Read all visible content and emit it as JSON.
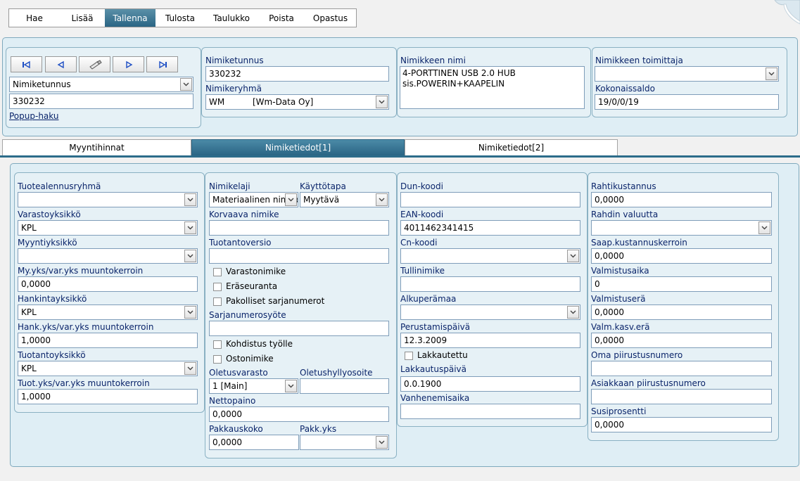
{
  "menu": [
    "Hae",
    "Lisää",
    "Tallenna",
    "Tulosta",
    "Taulukko",
    "Poista",
    "Opastus"
  ],
  "active_menu": "Tallenna",
  "search": {
    "field_select": "Nimiketunnus",
    "value": "330232",
    "popup_link": "Popup-haku"
  },
  "header": {
    "nimiketunnus_label": "Nimiketunnus",
    "nimiketunnus_value": "330232",
    "nimikeryhma_label": "Nimikeryhmä",
    "nimikeryhma_code": "WM",
    "nimikeryhma_name": "[Wm-Data Oy]",
    "nimi_label": "Nimikkeen nimi",
    "nimi_line1": "4-PORTTINEN USB 2.0 HUB",
    "nimi_line2": "sis.POWERIN+KAAPELIN",
    "toimittaja_label": "Nimikkeen toimittaja",
    "toimittaja_value": "",
    "kokonaissaldo_label": "Kokonaissaldo",
    "kokonaissaldo_value": "19/0/0/19"
  },
  "tabs": [
    "Myyntihinnat",
    "Nimiketiedot[1]",
    "Nimiketiedot[2]"
  ],
  "active_tab": "Nimiketiedot[1]",
  "col1": {
    "tuotealennusryhma_label": "Tuotealennusryhmä",
    "tuotealennusryhma_value": "",
    "varastoyksikko_label": "Varastoyksikkö",
    "varastoyksikko_value": "KPL",
    "myyntiyksikko_label": "Myyntiyksikkö",
    "myyntiyksikko_value": "",
    "myyks_label": "My.yks/var.yks muuntokerroin",
    "myyks_value": "0,0000",
    "hankintayksikko_label": "Hankintayksikkö",
    "hankintayksikko_value": "KPL",
    "hankyks_label": "Hank.yks/var.yks muuntokerroin",
    "hankyks_value": "1,0000",
    "tuotantoyksikko_label": "Tuotantoyksikkö",
    "tuotantoyksikko_value": "KPL",
    "tuotyks_label": "Tuot.yks/var.yks muuntokerroin",
    "tuotyks_value": "1,0000"
  },
  "col2": {
    "nimikelaji_label": "Nimikelaji",
    "nimikelaji_value": "Materiaalinen nimike",
    "kayttotapa_label": "Käyttötapa",
    "kayttotapa_value": "Myytävä",
    "korvaava_label": "Korvaava nimike",
    "korvaava_value": "",
    "tuotantoversio_label": "Tuotantoversio",
    "tuotantoversio_value": "",
    "varastonimike_label": "Varastonimike",
    "eraseuranta_label": "Eräseuranta",
    "pakolliset_label": "Pakolliset sarjanumerot",
    "sarjanumerosyote_label": "Sarjanumerosyöte",
    "sarjanumerosyote_value": "",
    "kohdistus_label": "Kohdistus työlle",
    "ostonimike_label": "Ostonimike",
    "oletusvarasto_label": "Oletusvarasto",
    "oletusvarasto_value": "1 [Main]",
    "oletushyllyosoite_label": "Oletushyllyosoite",
    "oletushyllyosoite_value": "",
    "nettopaino_label": "Nettopaino",
    "nettopaino_value": "0,0000",
    "pakkauskoko_label": "Pakkauskoko",
    "pakkauskoko_value": "0,0000",
    "pakkyks_label": "Pakk.yks",
    "pakkyks_value": ""
  },
  "col3": {
    "dun_label": "Dun-koodi",
    "dun_value": "",
    "ean_label": "EAN-koodi",
    "ean_value": "4011462341415",
    "cn_label": "Cn-koodi",
    "cn_value": "",
    "tullinimike_label": "Tullinimike",
    "tullinimike_value": "",
    "alkuperamaa_label": "Alkuperämaa",
    "alkuperamaa_value": "",
    "perustamispaiva_label": "Perustamispäivä",
    "perustamispaiva_value": "12.3.2009",
    "lakkautettu_label": "Lakkautettu",
    "lakkautuspaiva_label": "Lakkautuspäivä",
    "lakkautuspaiva_value": "0.0.1900",
    "vanhenemisaika_label": "Vanhenemisaika",
    "vanhenemisaika_value": ""
  },
  "col4": {
    "rahtikustannus_label": "Rahtikustannus",
    "rahtikustannus_value": "0,0000",
    "rahdin_valuutta_label": "Rahdin valuutta",
    "rahdin_valuutta_value": "",
    "saap_label": "Saap.kustannuskerroin",
    "saap_value": "0,0000",
    "valmistusaika_label": "Valmistusaika",
    "valmistusaika_value": "0",
    "valmistusera_label": "Valmistuserä",
    "valmistusera_value": "0,0000",
    "valmkasv_label": "Valm.kasv.erä",
    "valmkasv_value": "0,0000",
    "oma_piirustus_label": "Oma piirustusnumero",
    "oma_piirustus_value": "",
    "asiakkaan_piirustus_label": "Asiakkaan piirustusnumero",
    "asiakkaan_piirustus_value": "",
    "susiprosentti_label": "Susiprosentti",
    "susiprosentti_value": "0,0000"
  }
}
